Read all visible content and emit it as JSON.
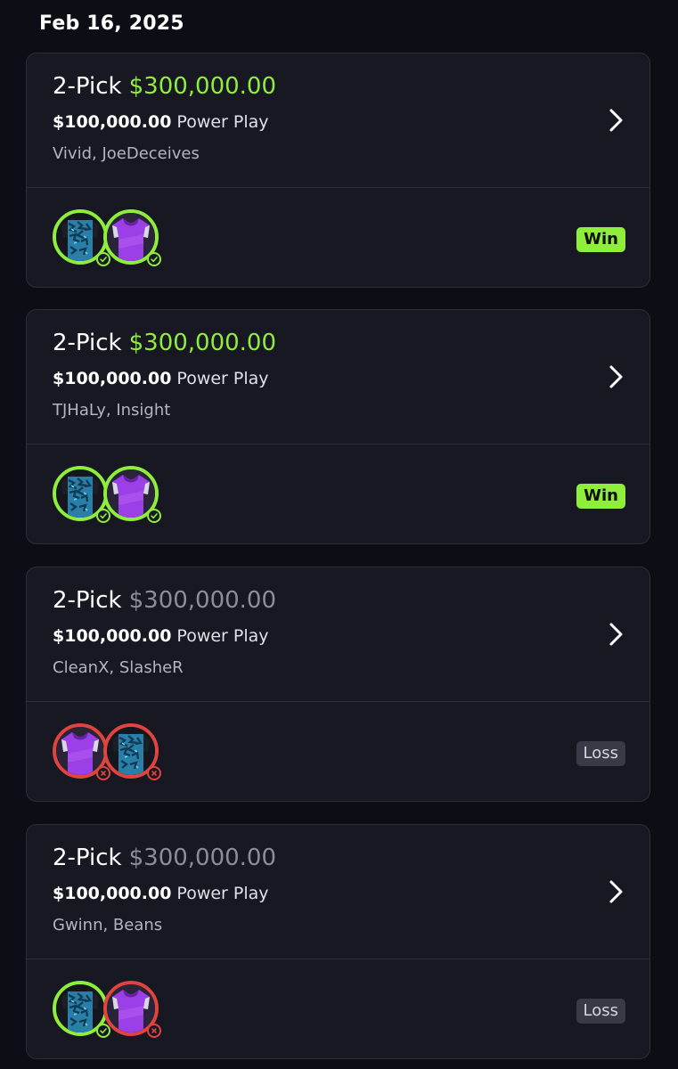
{
  "date_header": "Feb 16, 2025",
  "colors": {
    "background": "#0d0d15",
    "card": "#181822",
    "accent_green": "#8fed3b",
    "loss_red": "#e0443f",
    "muted": "#8d8d98"
  },
  "cards": [
    {
      "pick_label": "2-Pick",
      "payout": "$300,000.00",
      "entry_amount": "$100,000.00",
      "play_type": "Power Play",
      "players": "Vivid, JoeDeceives",
      "result": "Win",
      "picks": [
        {
          "jersey": "blue-camo",
          "status": "win"
        },
        {
          "jersey": "purple",
          "status": "win"
        }
      ]
    },
    {
      "pick_label": "2-Pick",
      "payout": "$300,000.00",
      "entry_amount": "$100,000.00",
      "play_type": "Power Play",
      "players": "TJHaLy, Insight",
      "result": "Win",
      "picks": [
        {
          "jersey": "blue-camo",
          "status": "win"
        },
        {
          "jersey": "purple",
          "status": "win"
        }
      ]
    },
    {
      "pick_label": "2-Pick",
      "payout": "$300,000.00",
      "entry_amount": "$100,000.00",
      "play_type": "Power Play",
      "players": "CleanX, SlasheR",
      "result": "Loss",
      "picks": [
        {
          "jersey": "purple",
          "status": "loss"
        },
        {
          "jersey": "blue-camo",
          "status": "loss"
        }
      ]
    },
    {
      "pick_label": "2-Pick",
      "payout": "$300,000.00",
      "entry_amount": "$100,000.00",
      "play_type": "Power Play",
      "players": "Gwinn, Beans",
      "result": "Loss",
      "picks": [
        {
          "jersey": "blue-camo",
          "status": "win"
        },
        {
          "jersey": "purple",
          "status": "loss"
        }
      ]
    }
  ]
}
